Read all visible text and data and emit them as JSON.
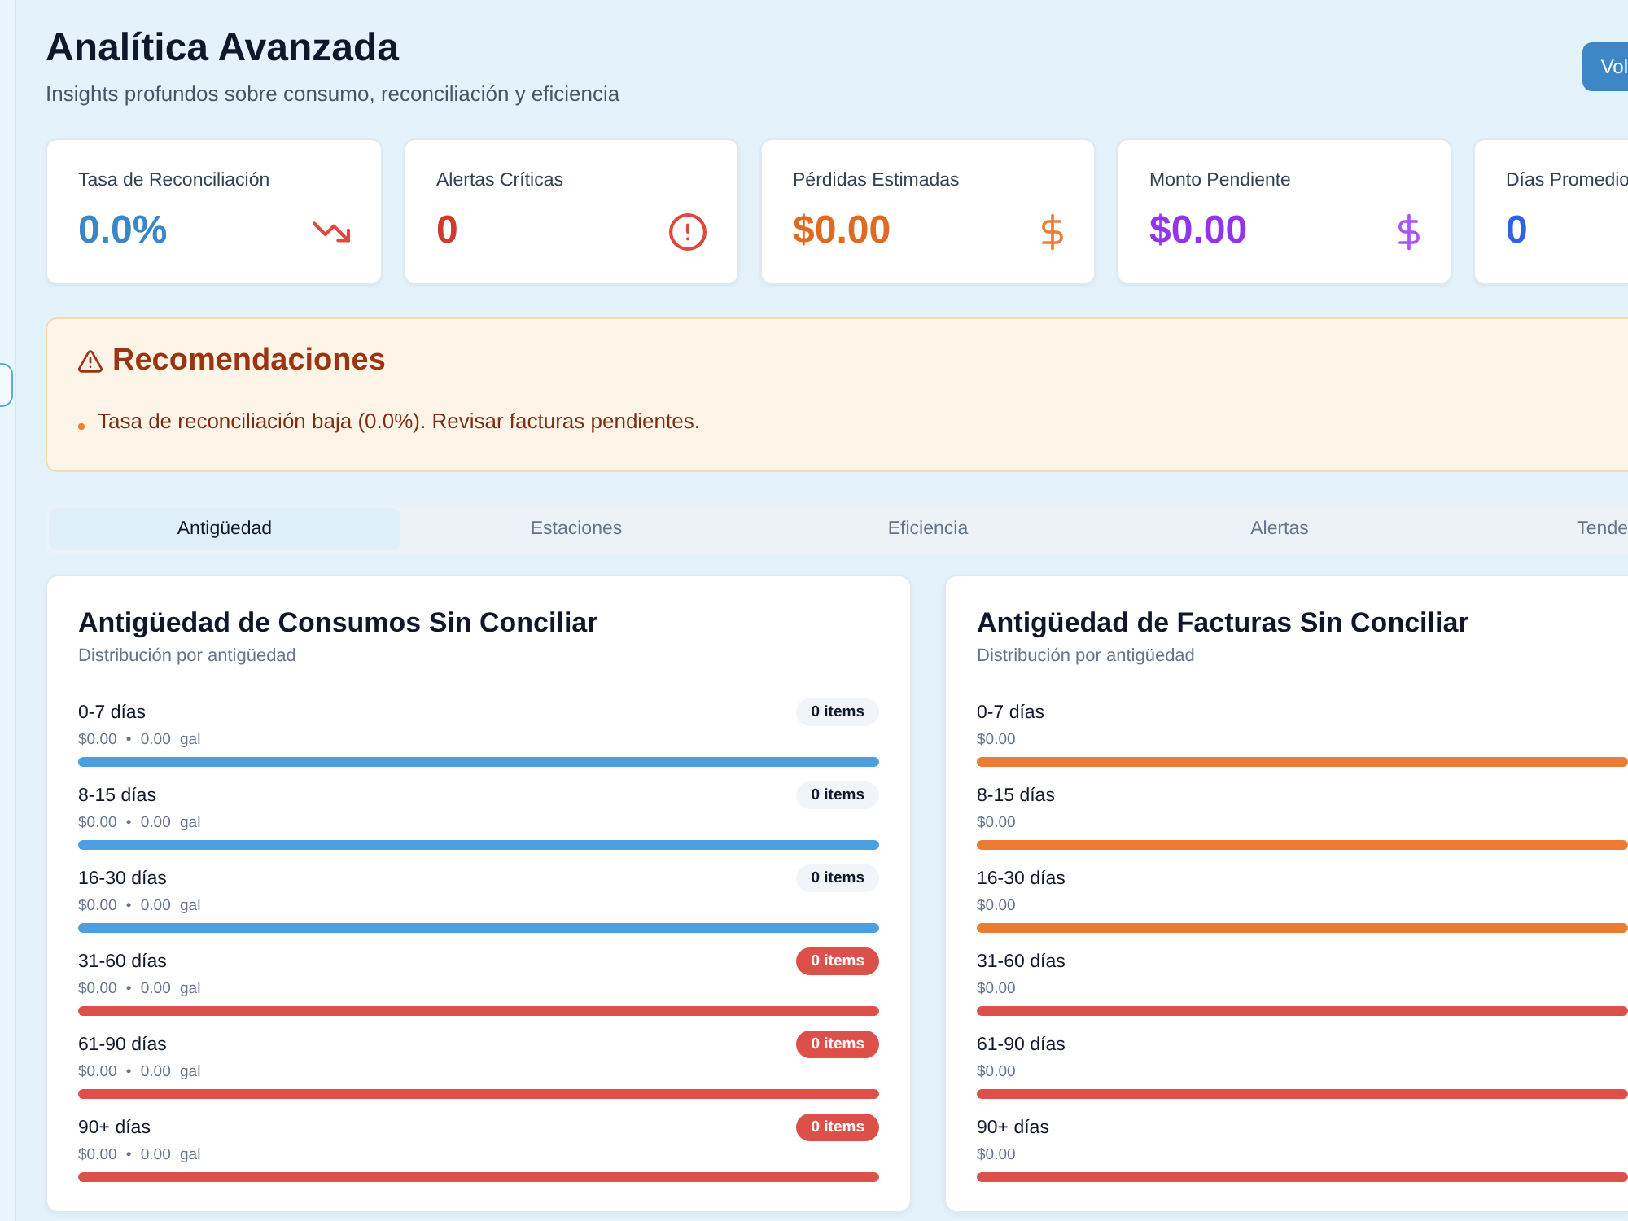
{
  "header": {
    "title": "Analítica Avanzada",
    "subtitle": "Insights profundos sobre consumo, reconciliación y eficiencia",
    "button": "Vol"
  },
  "kpis": [
    {
      "label": "Tasa de Reconciliación",
      "value": "0.0%",
      "color": "#3a86c8",
      "kind": "rate",
      "icon": {
        "color": "#e0483e"
      }
    },
    {
      "label": "Alertas Críticas",
      "value": "0",
      "color": "#cf3a2e",
      "kind": "alerts",
      "icon": {
        "color": "#e0483e"
      }
    },
    {
      "label": "Pérdidas Estimadas",
      "value": "$0.00",
      "color": "#e06a22",
      "kind": "money",
      "icon": {
        "color": "#ee7d33"
      }
    },
    {
      "label": "Monto Pendiente",
      "value": "$0.00",
      "color": "#9333ea",
      "kind": "money",
      "icon": {
        "color": "#a855f7"
      }
    },
    {
      "label": "Días Promedio",
      "value": "0",
      "color": "#2f63e6",
      "kind": "days"
    }
  ],
  "recommendations": {
    "title": "Recomendaciones",
    "items": [
      "Tasa de reconciliación baja (0.0%). Revisar facturas pendientes."
    ]
  },
  "tabs": [
    {
      "label": "Antigüedad",
      "selected": true
    },
    {
      "label": "Estaciones",
      "selected": false
    },
    {
      "label": "Eficiencia",
      "selected": false
    },
    {
      "label": "Alertas",
      "selected": false
    },
    {
      "label": "Tende",
      "selected": false
    }
  ],
  "panels": [
    {
      "title": "Antigüedad de Consumos Sin Conciliar",
      "subtitle": "Distribución por antigüedad",
      "rows": [
        {
          "label": "0-7 días",
          "count": "0 items",
          "highlight": false,
          "detail": "$0.00 • 0.00 gal",
          "color": "#4a9fe0"
        },
        {
          "label": "8-15 días",
          "count": "0 items",
          "highlight": false,
          "detail": "$0.00 • 0.00 gal",
          "color": "#4a9fe0"
        },
        {
          "label": "16-30 días",
          "count": "0 items",
          "highlight": false,
          "detail": "$0.00 • 0.00 gal",
          "color": "#4a9fe0"
        },
        {
          "label": "31-60 días",
          "count": "0 items",
          "highlight": true,
          "detail": "$0.00 • 0.00 gal",
          "color": "#dd504a"
        },
        {
          "label": "61-90 días",
          "count": "0 items",
          "highlight": true,
          "detail": "$0.00 • 0.00 gal",
          "color": "#dd504a"
        },
        {
          "label": "90+ días",
          "count": "0 items",
          "highlight": true,
          "detail": "$0.00 • 0.00 gal",
          "color": "#dd504a"
        }
      ]
    },
    {
      "title": "Antigüedad de Facturas Sin Conciliar",
      "subtitle": "Distribución por antigüedad",
      "rows": [
        {
          "label": "0-7 días",
          "detail": "$0.00",
          "color": "#ec7c31"
        },
        {
          "label": "8-15 días",
          "detail": "$0.00",
          "color": "#ec7c31"
        },
        {
          "label": "16-30 días",
          "detail": "$0.00",
          "color": "#ec7c31"
        },
        {
          "label": "31-60 días",
          "detail": "$0.00",
          "color": "#dd504a"
        },
        {
          "label": "61-90 días",
          "detail": "$0.00",
          "color": "#dd504a"
        },
        {
          "label": "90+ días",
          "detail": "$0.00",
          "color": "#dd504a"
        }
      ]
    }
  ]
}
